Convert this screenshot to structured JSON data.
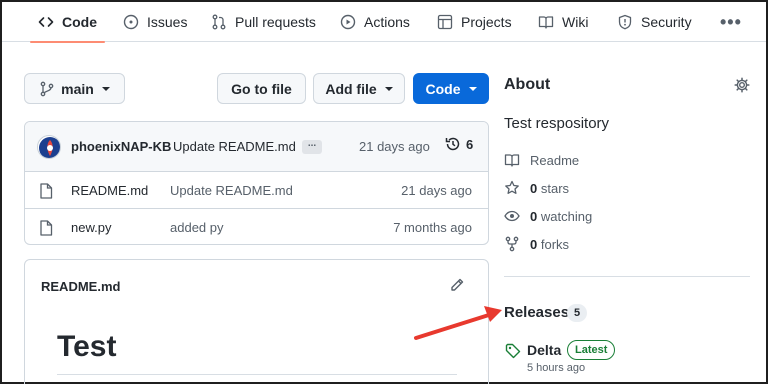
{
  "nav": {
    "tabs": [
      {
        "label": "Code",
        "icon": "code-icon"
      },
      {
        "label": "Issues",
        "icon": "issue-icon"
      },
      {
        "label": "Pull requests",
        "icon": "pull-request-icon"
      },
      {
        "label": "Actions",
        "icon": "play-icon"
      },
      {
        "label": "Projects",
        "icon": "table-icon"
      },
      {
        "label": "Wiki",
        "icon": "book-icon"
      },
      {
        "label": "Security",
        "icon": "shield-icon"
      }
    ],
    "more": "•••"
  },
  "toolbar": {
    "branch": "main",
    "go_to_file": "Go to file",
    "add_file": "Add file",
    "code": "Code"
  },
  "commit": {
    "author": "phoenixNAP-KB",
    "message": "Update README.md",
    "ellipsis": "...",
    "time": "21 days ago",
    "history_count": "6"
  },
  "files": [
    {
      "name": "README.md",
      "message": "Update README.md",
      "time": "21 days ago"
    },
    {
      "name": "new.py",
      "message": "added py",
      "time": "7 months ago"
    }
  ],
  "readme": {
    "filename": "README.md",
    "heading": "Test"
  },
  "about": {
    "title": "About",
    "description": "Test respository",
    "readme_label": "Readme",
    "stars_count": "0",
    "stars_label": "stars",
    "watching_count": "0",
    "watching_label": "watching",
    "forks_count": "0",
    "forks_label": "forks"
  },
  "releases": {
    "title": "Releases",
    "count": "5",
    "latest": {
      "name": "Delta",
      "badge": "Latest",
      "time": "5 hours ago"
    }
  },
  "colors": {
    "primary_button": "#0969da",
    "active_tab_underline": "#fd8c73",
    "latest_badge": "#1a7f37",
    "annotation_arrow": "#e8392e"
  }
}
